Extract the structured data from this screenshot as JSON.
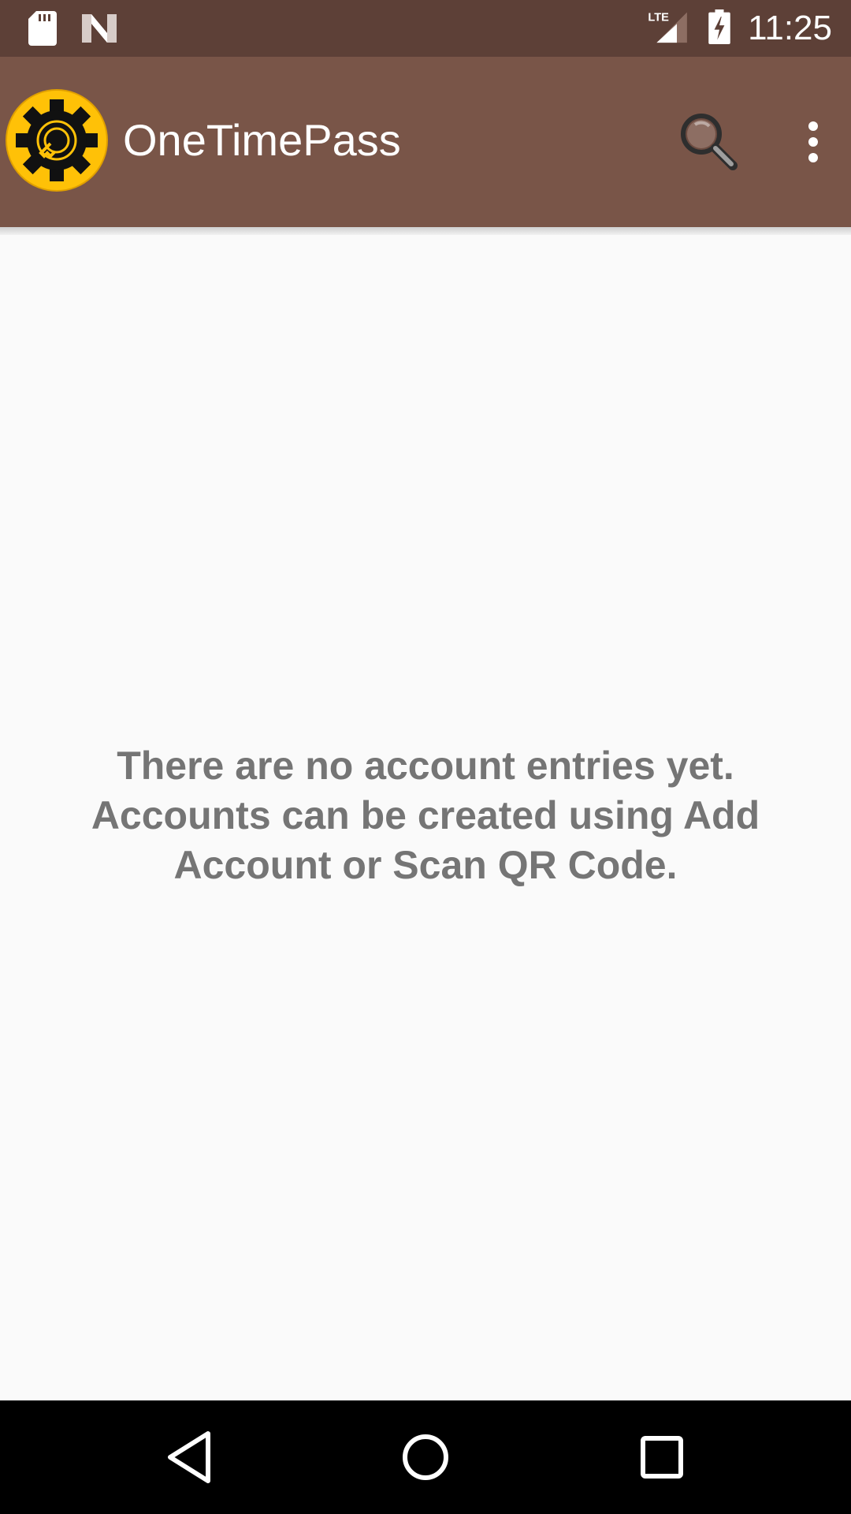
{
  "status_bar": {
    "time": "11:25",
    "network_label": "LTE",
    "icons": [
      "sd-card-icon",
      "n-notification-icon",
      "lte-signal-icon",
      "battery-charging-icon"
    ]
  },
  "app_bar": {
    "title": "OneTimePass",
    "logo_icon": "onetimepass-logo-icon",
    "actions": [
      "search-icon",
      "more-vert-icon"
    ]
  },
  "main": {
    "empty_message": "There are no account entries yet. Accounts can be created using Add Account or Scan QR Code."
  },
  "nav_bar": {
    "buttons": [
      "back-icon",
      "home-icon",
      "recents-icon"
    ]
  },
  "colors": {
    "status_bar": "#5D4037",
    "app_bar": "#795548",
    "background": "#FAFAFA",
    "message_text": "#757575",
    "logo_yellow": "#FFC107"
  }
}
